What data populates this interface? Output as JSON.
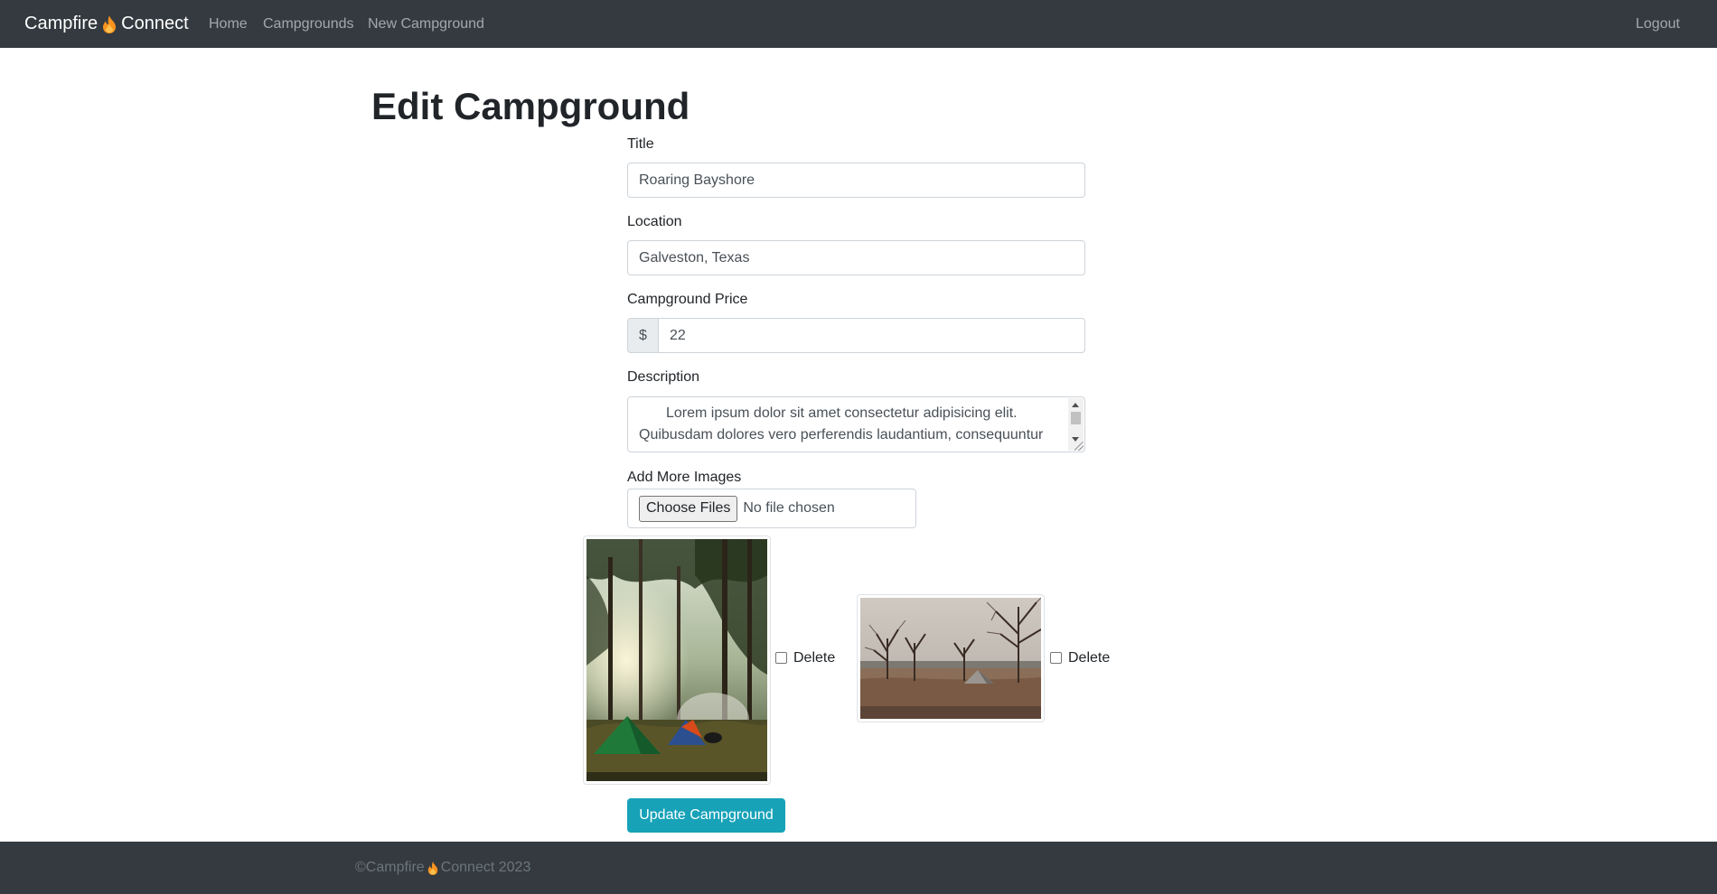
{
  "navbar": {
    "brand_prefix": "Campfire",
    "brand_suffix": "Connect",
    "brand_icon": "flame-icon",
    "links": {
      "home": "Home",
      "campgrounds": "Campgrounds",
      "new_campground": "New Campground",
      "logout": "Logout"
    }
  },
  "page": {
    "title": "Edit Campground"
  },
  "form": {
    "title_label": "Title",
    "title_value": "Roaring Bayshore",
    "location_label": "Location",
    "location_value": "Galveston, Texas",
    "price_label": "Campground Price",
    "price_prefix": "$",
    "price_value": "22",
    "description_label": "Description",
    "description_line1": "Lorem ipsum dolor sit amet consectetur adipisicing elit.",
    "description_line2": "Quibusdam dolores vero perferendis laudantium, consequuntur",
    "images_label": "Add More Images",
    "choose_files_label": "Choose Files",
    "no_file_text": "No file chosen",
    "images": [
      {
        "delete_label": "Delete",
        "checked": false
      },
      {
        "delete_label": "Delete",
        "checked": false
      }
    ],
    "submit_label": "Update Campground"
  },
  "footer": {
    "prefix": "©Campfire",
    "suffix": "Connect 2023"
  },
  "colors": {
    "navbar_bg": "#343a40",
    "accent": "#17a2b8",
    "flame": "#f7931e"
  }
}
